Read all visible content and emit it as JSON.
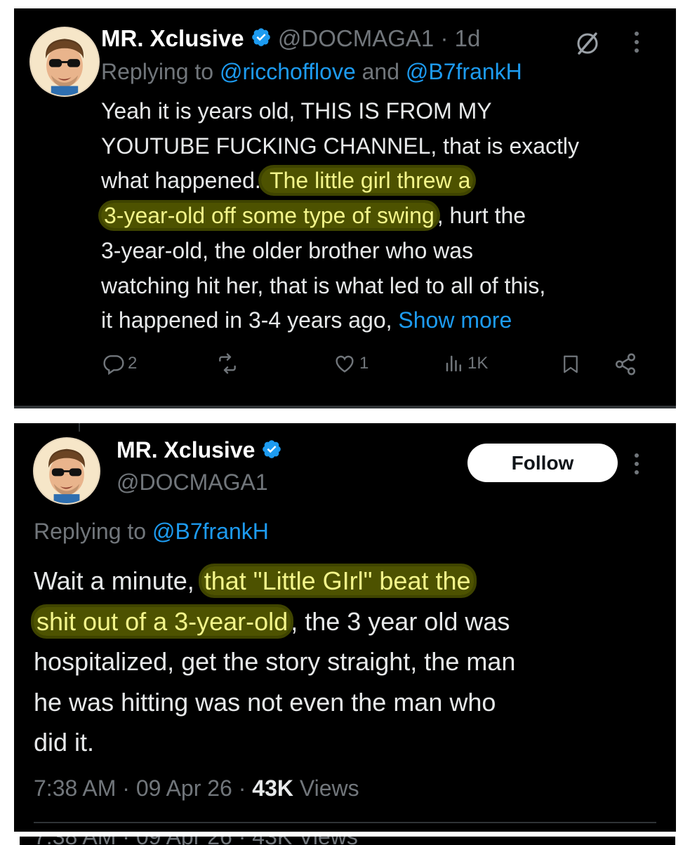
{
  "tweet1": {
    "display_name": "MR. Xclusive",
    "handle": "@DOCMAGA1",
    "time": "· 1d",
    "replying_prefix": "Replying to ",
    "replying_user1": "@ricchofflove",
    "replying_and": " and ",
    "replying_user2": "@B7frankH",
    "body": {
      "l1": "Yeah it is years old, THIS IS FROM MY",
      "l2": "YOUTUBE FUCKING CHANNEL, that is exactly",
      "l3_pre": "what happened.",
      "l3_hl": " The little girl threw a",
      "l4_hl": "3-year-old off some type of swing",
      "l4_post": ", hurt the",
      "l5": "3-year-old, the older brother who was",
      "l6": "watching hit her, that is what led to all of this,",
      "l7_pre": "it happened in 3-4 years ago, ",
      "l7_more": "Show more"
    },
    "actions": {
      "replies": "2",
      "likes": "1",
      "views": "1K"
    }
  },
  "tweet2": {
    "display_name": "MR. Xclusive",
    "handle": "@DOCMAGA1",
    "follow_label": "Follow",
    "replying_prefix": "Replying to ",
    "replying_user": "@B7frankH",
    "body": {
      "l1_pre": "Wait a minute, ",
      "l1_hl": "that \"Little GIrl\" beat the",
      "l2_hl": "shit out of a 3-year-old",
      "l2_post": ", the 3 year old was",
      "l3": "hospitalized, get the story straight, the man",
      "l4": "he was hitting was not even the man who",
      "l5": "did it."
    },
    "meta_time": "7:38 AM · 09 Apr 26 · ",
    "meta_views_count": "43K",
    "meta_views_label": " Views"
  },
  "partial_meta": "7:38 AM · 09 Apr 26 · 43K Views",
  "colors": {
    "background": "#000000",
    "text": "#e7e9ea",
    "secondary": "#71767b",
    "link": "#1d9bf0",
    "highlight": "#8c9600",
    "verified": "#1d9bf0"
  },
  "icons": [
    "verified-badge-icon",
    "grok-icon",
    "more-icon",
    "reply-icon",
    "repost-icon",
    "like-icon",
    "views-icon",
    "bookmark-icon",
    "share-icon"
  ]
}
